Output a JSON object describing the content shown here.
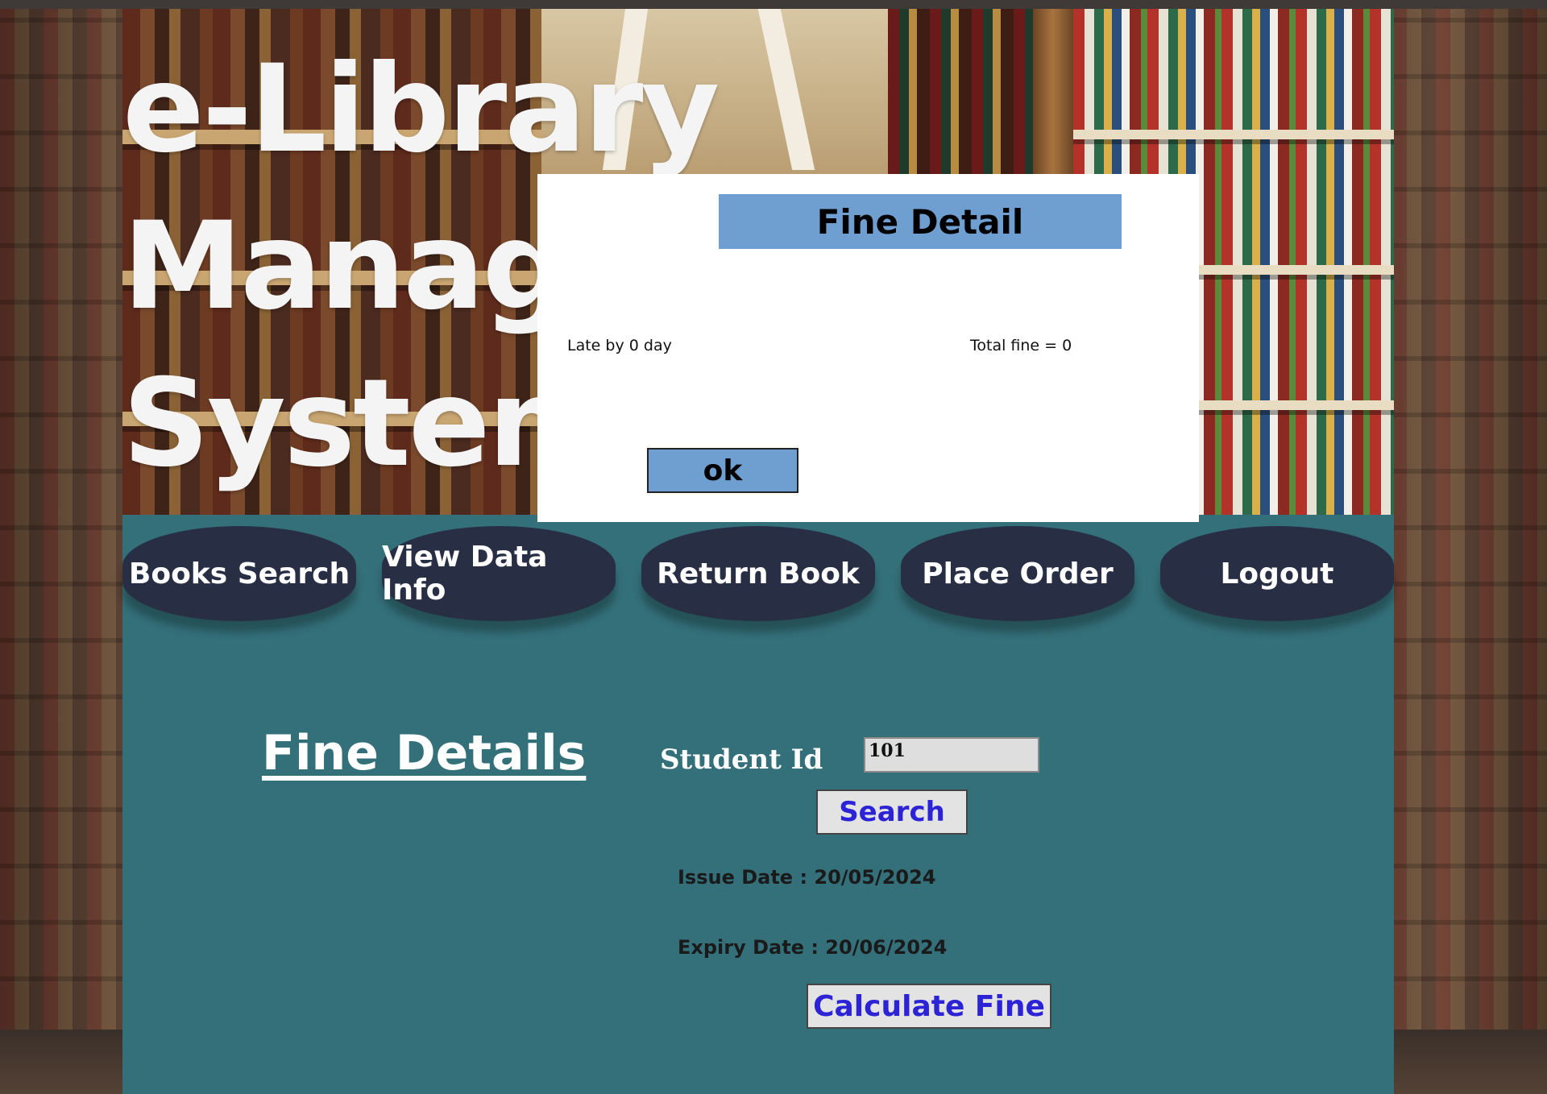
{
  "app": {
    "title_lines": [
      "e-Library",
      "Management",
      "System"
    ]
  },
  "nav": {
    "items": [
      {
        "label": "Books Search"
      },
      {
        "label": "View Data Info"
      },
      {
        "label": "Return Book"
      },
      {
        "label": "Place Order"
      },
      {
        "label": "Logout"
      }
    ]
  },
  "main": {
    "section_title": "Fine Details",
    "student_id_label": "Student Id",
    "student_id_value": "101",
    "search_label": "Search",
    "issue_date": "Issue Date : 20/05/2024",
    "expiry_date": "Expiry Date : 20/06/2024",
    "calculate_label": "Calculate Fine"
  },
  "dialog": {
    "title": "Fine Detail",
    "late_text": "Late by 0 day",
    "total_fine_text": "Total fine = 0",
    "ok_label": "ok"
  },
  "colors": {
    "nav_background": "#34707a",
    "nav_button": "#282f45",
    "dialog_accent": "#6f9fd1",
    "button_text": "#2d23d6"
  }
}
